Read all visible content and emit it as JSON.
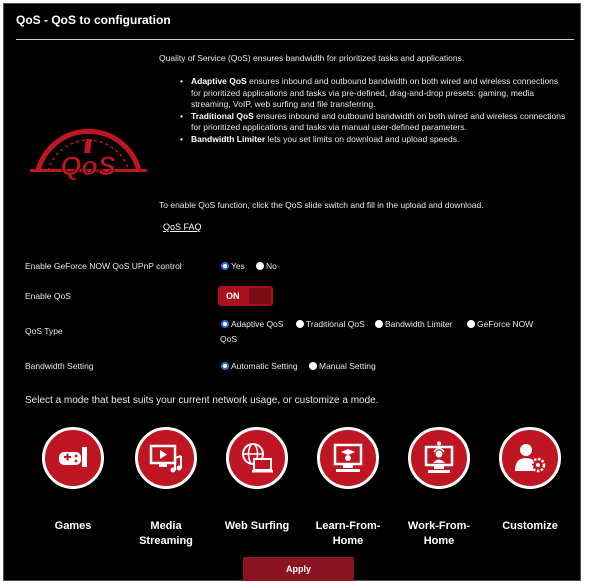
{
  "page": {
    "title": "QoS - QoS to configuration"
  },
  "description": {
    "intro": "Quality of Service (QoS) ensures bandwidth for prioritized tasks and applications.",
    "bullets": [
      {
        "name": "Adaptive QoS",
        "text": " ensures inbound and outbound bandwidth on both wired and wireless connections for prioritized applications and tasks via pre-defined, drag-and-drop presets: gaming, media streaming, VoIP, web surfing and file transferring."
      },
      {
        "name": "Traditional QoS",
        "text": " ensures inbound and outbound bandwidth on both wired and wireless connections for prioritized applications and tasks via manual user-defined parameters."
      },
      {
        "name": "Bandwidth Limiter",
        "text": " lets you set limits on download and upload speeds."
      }
    ],
    "enable_text": "To enable QoS function, click the QoS slide switch and fill in the upload and download.",
    "faq_link": "QoS FAQ"
  },
  "logo": {
    "text": "QoS",
    "color": "#c01522"
  },
  "settings": {
    "geforce_upnp": {
      "label": "Enable GeForce NOW QoS UPnP control",
      "options": [
        "Yes",
        "No"
      ],
      "selected": "Yes"
    },
    "enable_qos": {
      "label": "Enable QoS",
      "state": "ON"
    },
    "qos_type": {
      "label": "QoS Type",
      "options": [
        "Adaptive QoS",
        "Traditional QoS",
        "Bandwidth Limiter",
        "GeForce NOW",
        "QoS"
      ],
      "selected": "Adaptive QoS"
    },
    "bandwidth_setting": {
      "label": "Bandwidth Setting",
      "options": [
        "Automatic Setting",
        "Manual Setting"
      ],
      "selected": "Automatic Setting"
    }
  },
  "modes": {
    "heading": "Select a mode that best suits your current network usage, or customize a mode.",
    "items": [
      {
        "line1": "Games",
        "line2": "",
        "icon": "gamepad-icon"
      },
      {
        "line1": "Media",
        "line2": "Streaming",
        "icon": "media-streaming-icon"
      },
      {
        "line1": "Web Surfing",
        "line2": "",
        "icon": "web-surfing-icon"
      },
      {
        "line1": "Learn-From-",
        "line2": "Home",
        "icon": "learn-from-home-icon"
      },
      {
        "line1": "Work-From-",
        "line2": "Home",
        "icon": "work-from-home-icon"
      },
      {
        "line1": "Customize",
        "line2": "",
        "icon": "customize-icon"
      }
    ]
  },
  "actions": {
    "apply": "Apply"
  },
  "colors": {
    "accent": "#c01522",
    "toggle_on": "#a8101e",
    "apply_button": "#8a1420",
    "radio_selected": "#2f6fd6"
  }
}
